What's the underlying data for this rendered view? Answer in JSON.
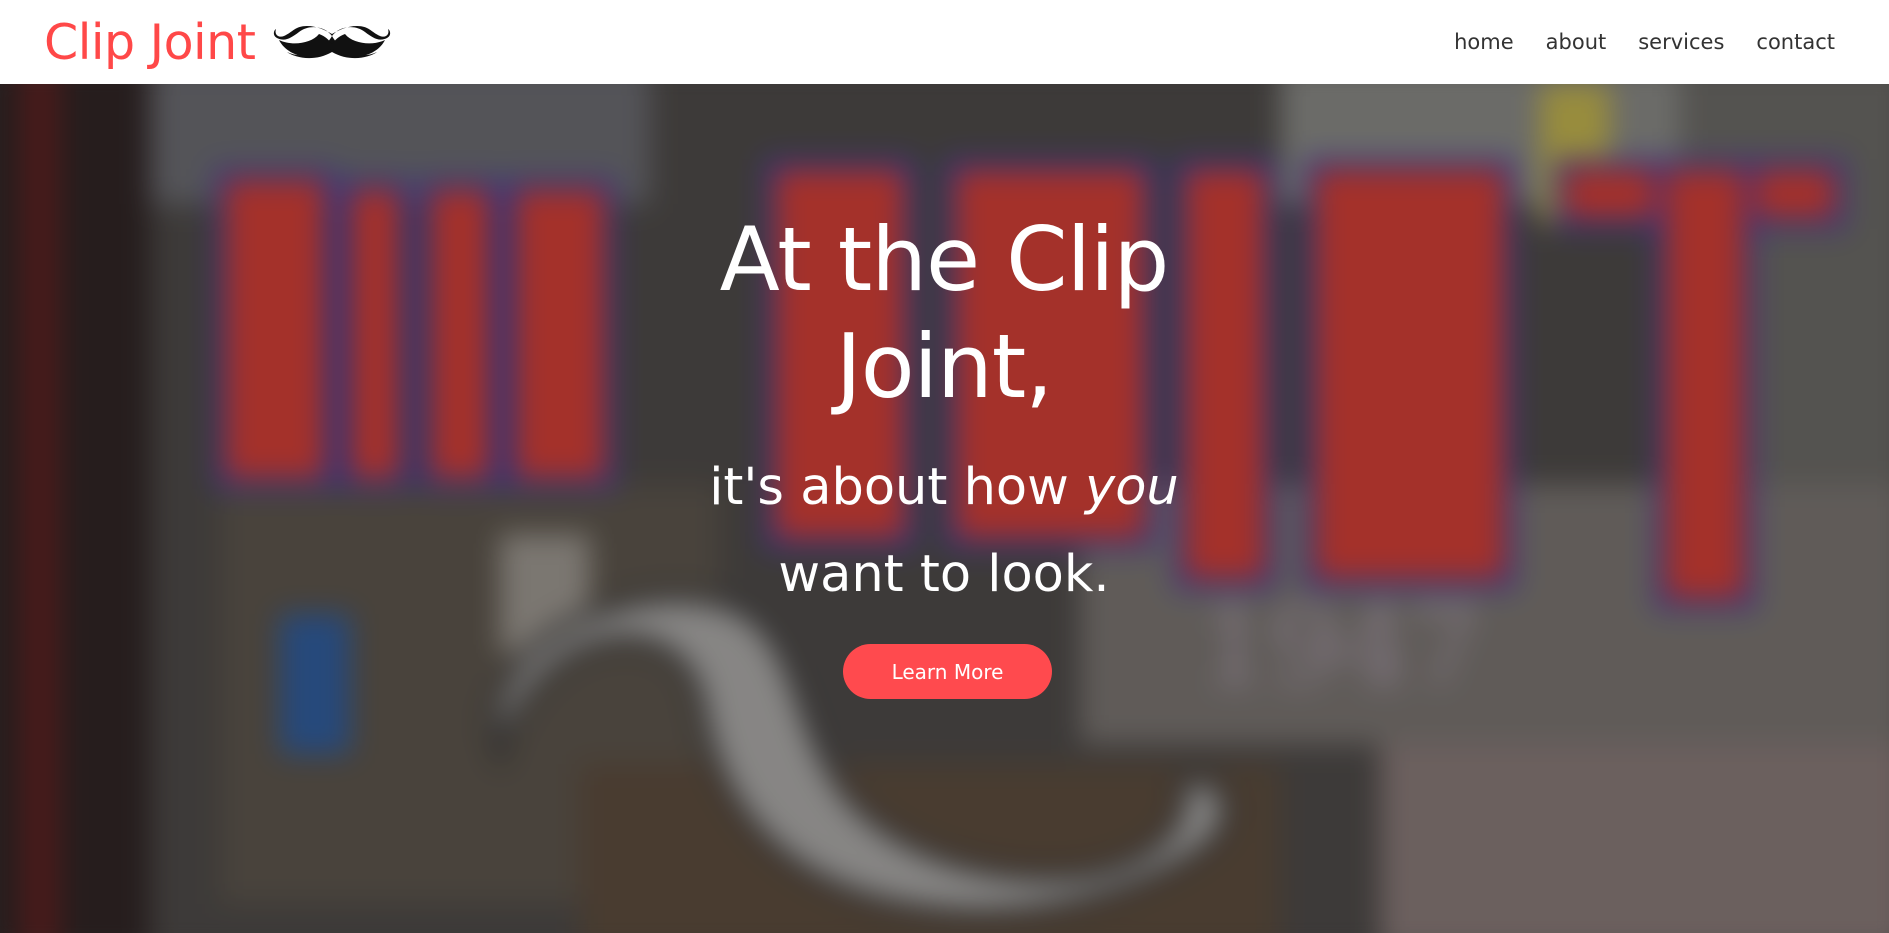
{
  "brand": {
    "name": "Clip Joint",
    "logo_icon": "mustache-icon",
    "color": "#ff4848"
  },
  "nav": {
    "items": [
      {
        "label": "home"
      },
      {
        "label": "about"
      },
      {
        "label": "services"
      },
      {
        "label": "contact"
      }
    ]
  },
  "hero": {
    "title": "At the Clip Joint,",
    "subtitle_before": "it's about how ",
    "subtitle_emphasis": "you",
    "subtitle_after": "want to look.",
    "cta_label": "Learn More",
    "cta_color": "#ff4a4e",
    "background_sign_text": "CLIP JOINT",
    "background_sign_year": "1947"
  }
}
